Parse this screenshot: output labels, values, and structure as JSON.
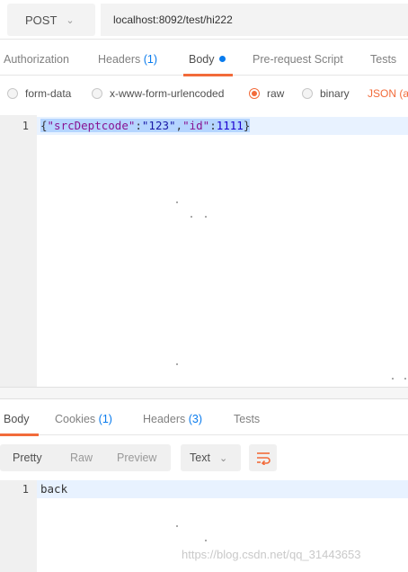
{
  "request": {
    "method": "POST",
    "url": "localhost:8092/test/hi222"
  },
  "request_tabs": [
    {
      "label": "Authorization"
    },
    {
      "label": "Headers",
      "count": "(1)"
    },
    {
      "label": "Body"
    },
    {
      "label": "Pre-request Script"
    },
    {
      "label": "Tests"
    }
  ],
  "body_types": [
    {
      "label": "form-data",
      "selected": false
    },
    {
      "label": "x-www-form-urlencoded",
      "selected": false
    },
    {
      "label": "raw",
      "selected": true
    },
    {
      "label": "binary",
      "selected": false
    }
  ],
  "raw_format": "JSON (ap",
  "request_editor": {
    "line_number": "1",
    "json": {
      "open": "{",
      "key1": "\"srcDeptcode\"",
      "colon1": ":",
      "val1": "\"123\"",
      "comma": ",",
      "key2": "\"id\"",
      "colon2": ":",
      "val2": "1111",
      "close": "}"
    }
  },
  "response_tabs": [
    {
      "label": "Body"
    },
    {
      "label": "Cookies",
      "count": "(1)"
    },
    {
      "label": "Headers",
      "count": "(3)"
    },
    {
      "label": "Tests"
    }
  ],
  "view_modes": [
    {
      "label": "Pretty",
      "active": true
    },
    {
      "label": "Raw",
      "active": false
    },
    {
      "label": "Preview",
      "active": false
    }
  ],
  "response_format": "Text",
  "response_editor": {
    "line_number": "1",
    "text": "back"
  },
  "watermark": "https://blog.csdn.net/qq_31443653",
  "colors": {
    "accent": "#f26b3a",
    "link": "#097bed"
  }
}
